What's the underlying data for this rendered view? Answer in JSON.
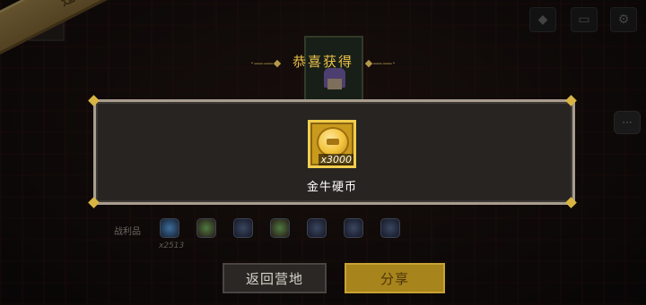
{
  "banner": {
    "text": "过关"
  },
  "popup": {
    "title": "恭喜获得",
    "title_deco_left": "·——◆",
    "title_deco_right": "◆——·",
    "reward": {
      "name": "金牛硬币",
      "quantity": "x3000",
      "icon": "gold-ox-coin-icon"
    }
  },
  "loot": {
    "label": "战利品",
    "first_count": "x2513",
    "icons": [
      "blue-gem-icon",
      "green-pot-icon",
      "dark-armor-icon",
      "green-pot-icon",
      "dark-armor-icon",
      "dark-armor-icon",
      "dark-armor-icon"
    ]
  },
  "buttons": {
    "back": "返回营地",
    "share": "分享"
  },
  "colors": {
    "gold": "#ecc24a",
    "panel_bg": "#272422",
    "share_button": "#a8841c"
  }
}
